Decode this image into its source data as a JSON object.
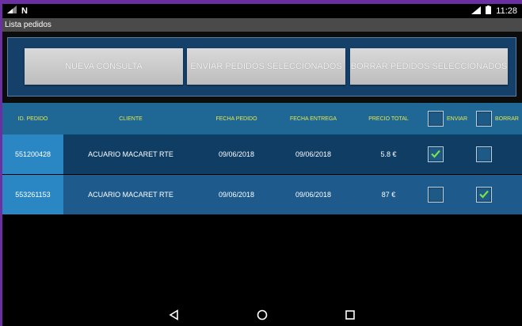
{
  "status": {
    "time": "11:28",
    "carrier": "N",
    "net": "LTE"
  },
  "title": "Lista pedidos",
  "buttons": {
    "new": "NUEVA CONSULTA",
    "send": "ENVIAR PEDIDOS SELECCIONADOS",
    "delete": "BORRAR PEDIDOS SELECCIONADOS"
  },
  "table": {
    "headers": {
      "id": "ID. PEDIDO",
      "client": "CLIENTE",
      "order_date": "FECHA PEDIDO",
      "delivery_date": "FECHA ENTREGA",
      "total": "PRECIO TOTAL",
      "send": "ENVIAR",
      "delete": "BORRAR"
    },
    "rows": [
      {
        "id": "551200428",
        "client": "ACUARIO MACARET RTE",
        "order_date": "09/06/2018",
        "delivery_date": "09/06/2018",
        "total": "5.8 €",
        "send": true,
        "delete": false
      },
      {
        "id": "553261153",
        "client": "ACUARIO MACARET RTE",
        "order_date": "09/06/2018",
        "delivery_date": "09/06/2018",
        "total": "87 €",
        "send": false,
        "delete": true
      }
    ]
  },
  "colors": {
    "header": "#1f6795",
    "row_dark": "#103d64",
    "row_light": "#1e5a8c",
    "accent": "#2a87c4",
    "header_text": "#e8e84a"
  }
}
